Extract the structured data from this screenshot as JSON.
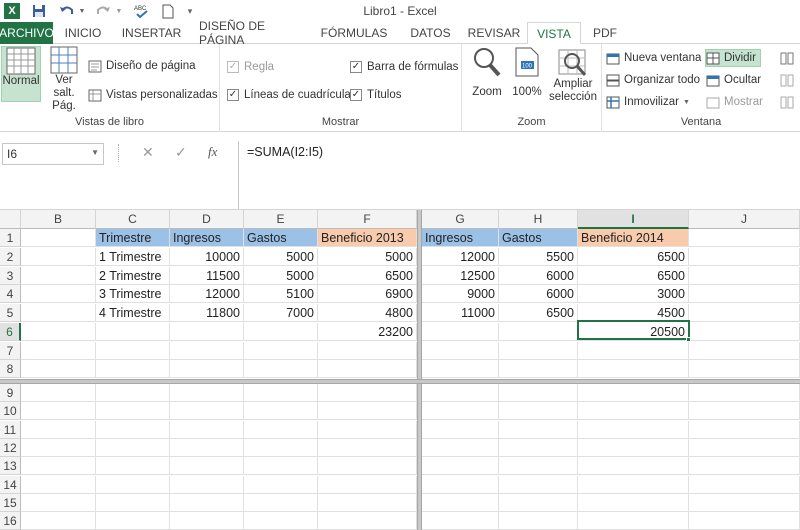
{
  "app": {
    "title": "Libro1 - Excel",
    "logo": "X"
  },
  "quick_access": {
    "icons": [
      "save-icon",
      "undo-icon",
      "redo-icon",
      "spelling-icon",
      "new-doc-icon",
      "customize-icon"
    ]
  },
  "tabs": [
    {
      "label": "ARCHIVO"
    },
    {
      "label": "INICIO"
    },
    {
      "label": "INSERTAR"
    },
    {
      "label": "DISEÑO DE PÁGINA"
    },
    {
      "label": "FÓRMULAS"
    },
    {
      "label": "DATOS"
    },
    {
      "label": "REVISAR"
    },
    {
      "label": "VISTA"
    },
    {
      "label": "PDF"
    }
  ],
  "ribbon": {
    "vistas": {
      "label": "Vistas de libro",
      "normal": "Normal",
      "ver_salt_1": "Ver salt.",
      "ver_salt_2": "Pág.",
      "diseno": "Diseño de página",
      "personalizadas": "Vistas personalizadas"
    },
    "mostrar": {
      "label": "Mostrar",
      "regla": "Regla",
      "lineas": "Líneas de cuadrícula",
      "barra": "Barra de fórmulas",
      "titulos": "Títulos"
    },
    "zoom": {
      "label": "Zoom",
      "zoom": "Zoom",
      "pct": "100%",
      "ampliar_1": "Ampliar",
      "ampliar_2": "selección"
    },
    "ventana": {
      "label": "Ventana",
      "nueva": "Nueva ventana",
      "organizar": "Organizar todo",
      "inmovilizar": "Inmovilizar",
      "dividir": "Dividir",
      "ocultar": "Ocultar",
      "mostrar": "Mostrar"
    }
  },
  "formula_bar": {
    "name_box": "I6",
    "formula": "=SUMA(I2:I5)",
    "fx": "fx"
  },
  "columns_left": [
    "B",
    "C",
    "D",
    "E",
    "F"
  ],
  "columns_right": [
    "G",
    "H",
    "I",
    "J"
  ],
  "rows_top": [
    "1",
    "2",
    "3",
    "4",
    "5",
    "6",
    "7",
    "8"
  ],
  "rows_bottom": [
    "9",
    "10",
    "11",
    "12",
    "13",
    "14",
    "15",
    "16"
  ],
  "sheet": {
    "C1": "Trimestre",
    "D1": "Ingresos",
    "E1": "Gastos",
    "F1": "Beneficio 2013",
    "G1": "Ingresos",
    "H1": "Gastos",
    "I1": "Beneficio 2014",
    "C2": "1 Trimestre",
    "D2": "10000",
    "E2": "5000",
    "F2": "5000",
    "G2": "12000",
    "H2": "5500",
    "I2": "6500",
    "C3": "2 Trimestre",
    "D3": "11500",
    "E3": "5000",
    "F3": "6500",
    "G3": "12500",
    "H3": "6000",
    "I3": "6500",
    "C4": "3 Trimestre",
    "D4": "12000",
    "E4": "5100",
    "F4": "6900",
    "G4": "9000",
    "H4": "6000",
    "I4": "3000",
    "C5": "4 Trimestre",
    "D5": "11800",
    "E5": "7000",
    "F5": "4800",
    "G5": "11000",
    "H5": "6500",
    "I5": "4500",
    "F6": "23200",
    "I6": "20500"
  },
  "colors": {
    "excel_green": "#217346",
    "header_blue": "#9bc2e6",
    "header_orange": "#f8cbad"
  }
}
